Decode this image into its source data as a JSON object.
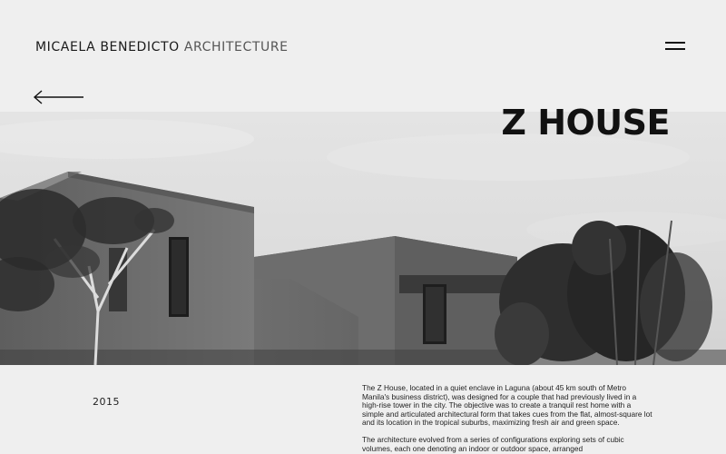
{
  "header": {
    "brand_name": "MICAELA BENEDICTO",
    "brand_sub": "ARCHITECTURE"
  },
  "nav": {
    "menu_icon": "hamburger-menu-icon",
    "back_icon": "arrow-left-icon"
  },
  "project": {
    "title": "Z HOUSE",
    "year": "2015",
    "hero_image": "black-and-white photograph of concrete box house with trees",
    "description": [
      "The Z House, located in a quiet enclave in Laguna (about 45 km south of Metro Manila's business district), was designed for a couple that had previously lived in a high-rise tower in the city. The objective was to create a tranquil rest home with a simple and articulated architectural form that takes cues from the flat, almost-square lot and its location in the tropical suburbs, maximizing fresh air and green space.",
      "The architecture evolved from a series of configurations exploring sets of cubic volumes, each one denoting an indoor or outdoor space, arranged"
    ]
  },
  "colors": {
    "background": "#efefef",
    "text": "#111111"
  }
}
